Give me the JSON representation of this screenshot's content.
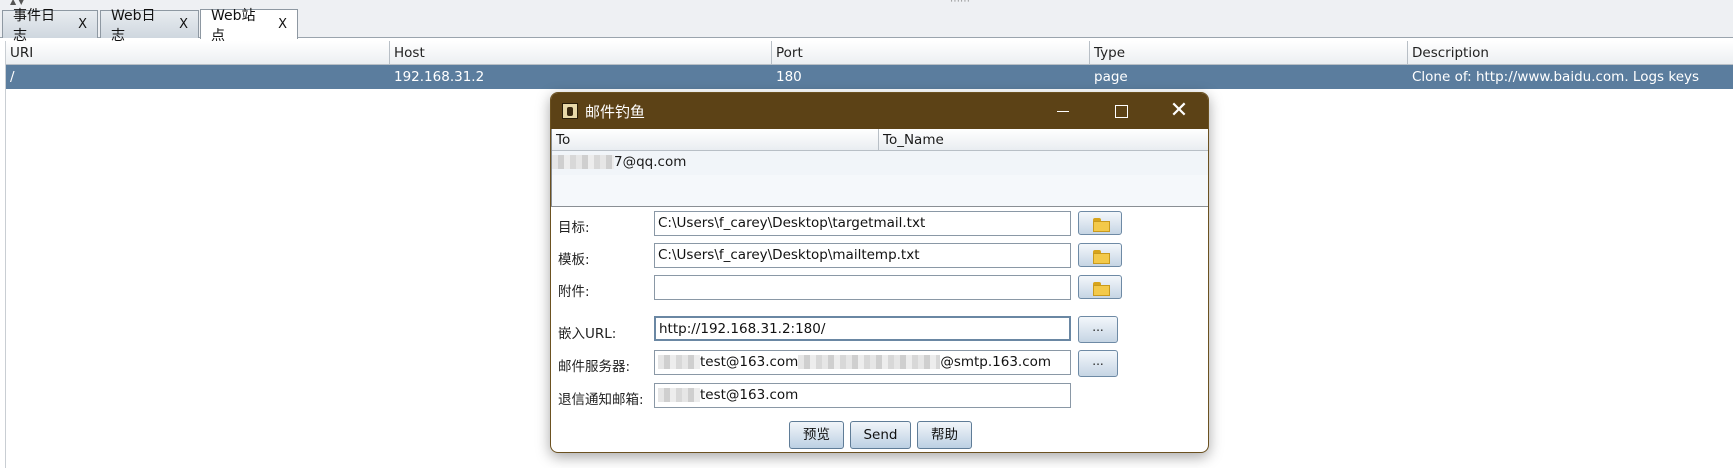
{
  "tabs": [
    {
      "label": "事件日志",
      "close": "X"
    },
    {
      "label": "Web日志",
      "close": "X"
    },
    {
      "label": "Web站点",
      "close": "X"
    }
  ],
  "sites_table": {
    "columns": [
      "URI",
      "Host",
      "Port",
      "Type",
      "Description"
    ],
    "rows": [
      {
        "uri": "/",
        "host": "192.168.31.2",
        "port": "180",
        "type": "page",
        "description": "Clone of: http://www.baidu.com. Logs keys"
      }
    ]
  },
  "dialog": {
    "title": "邮件钓鱼",
    "recipients": {
      "columns": [
        "To",
        "To_Name"
      ],
      "rows": [
        {
          "to_visible": "7@qq.com",
          "to_name": ""
        }
      ]
    },
    "fields": {
      "target": {
        "label": "目标:",
        "value": "C:\\Users\\f_carey\\Desktop\\targetmail.txt"
      },
      "template": {
        "label": "模板:",
        "value": "C:\\Users\\f_carey\\Desktop\\mailtemp.txt"
      },
      "attachment": {
        "label": "附件:",
        "value": ""
      },
      "embed_url": {
        "label": "嵌入URL:",
        "value": "http://192.168.31.2:180/"
      },
      "mail_server": {
        "label": "邮件服务器:",
        "value_part1": "test@163.com",
        "value_part2": "@smtp.163.com"
      },
      "bounce": {
        "label": "退信通知邮箱:",
        "value": "test@163.com"
      }
    },
    "buttons": {
      "preview": "预览",
      "send": "Send",
      "help": "帮助",
      "browse_dots": "..."
    }
  },
  "colors": {
    "selected_row": "#5b7d9e",
    "dialog_title": "#5c4216"
  }
}
